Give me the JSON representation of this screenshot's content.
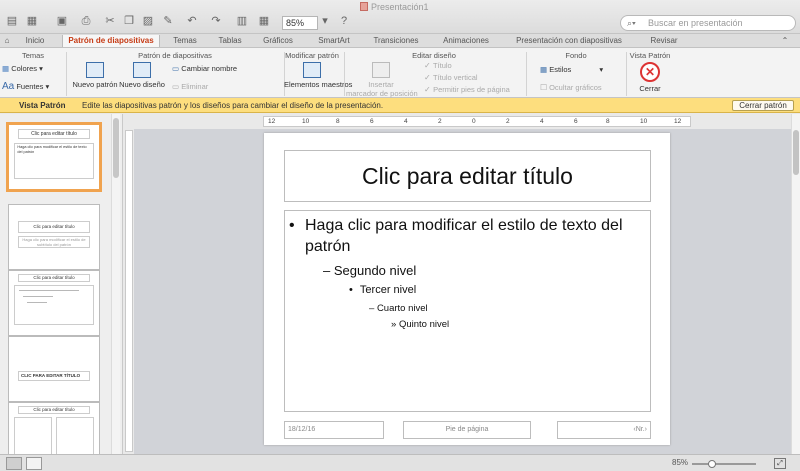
{
  "window": {
    "title": "Presentación1",
    "zoom": "85%",
    "search_placeholder": "Buscar en presentación"
  },
  "tabs": [
    "Inicio",
    "Patrón de diapositivas",
    "Temas",
    "Tablas",
    "Gráficos",
    "SmartArt",
    "Transiciones",
    "Animaciones",
    "Presentación con diapositivas",
    "Revisar"
  ],
  "ribbon": {
    "groups": {
      "temas": "Temas",
      "patron": "Patrón de diapositivas",
      "modificar": "Modificar patrón",
      "editar": "Editar diseño",
      "fondo": "Fondo",
      "vista": "Vista Patrón"
    },
    "colors": "Colores",
    "fonts": "Fuentes",
    "new_master": "Nuevo patrón",
    "new_layout": "Nuevo diseño",
    "rename": "Cambiar nombre",
    "delete": "Eliminar",
    "master_elements": "Elementos maestros",
    "insert_placeholder_1": "Insertar",
    "insert_placeholder_2": "marcador de posición",
    "chk_title": "Título",
    "chk_vertical": "Título vertical",
    "chk_footers": "Permitir pies de página",
    "styles": "Estilos",
    "hide_graphics": "Ocultar gráficos",
    "close": "Cerrar"
  },
  "infobar": {
    "label": "Vista Patrón",
    "text": "Edite las diapositivas patrón y los diseños para cambiar el diseño de la presentación.",
    "button": "Cerrar patrón"
  },
  "ruler": {
    "ticks": [
      "12",
      "10",
      "8",
      "6",
      "4",
      "2",
      "0",
      "2",
      "4",
      "6",
      "8",
      "10",
      "12"
    ]
  },
  "slide": {
    "title": "Clic para editar título",
    "levels": [
      "Haga clic para modificar el estilo de texto del",
      "patrón",
      "Segundo nivel",
      "Tercer nivel",
      "Cuarto nivel",
      "Quinto nivel"
    ],
    "bullets": [
      "•",
      "–",
      "•",
      "–",
      "»"
    ],
    "footer_date": "18/12/16",
    "footer_center": "Pie de página",
    "footer_num": "‹Nr.›"
  },
  "thumbnails": {
    "t1_title": "Clic para editar título",
    "t1_body": "Haga clic para modificar el estilo de texto del patrón",
    "t2_title": "Clic para editar título",
    "t2_sub": "Haga clic para modificar el estilo de subtítulo del patrón",
    "t3_title": "Clic para editar título",
    "t4_title": "CLIC PARA EDITAR TÍTULO",
    "t5_title": "Clic para editar título"
  },
  "status": {
    "zoom": "85%"
  },
  "colors": {
    "accent": "#c63b15",
    "infobar": "#fdde7e",
    "selection": "#f0a34f"
  }
}
